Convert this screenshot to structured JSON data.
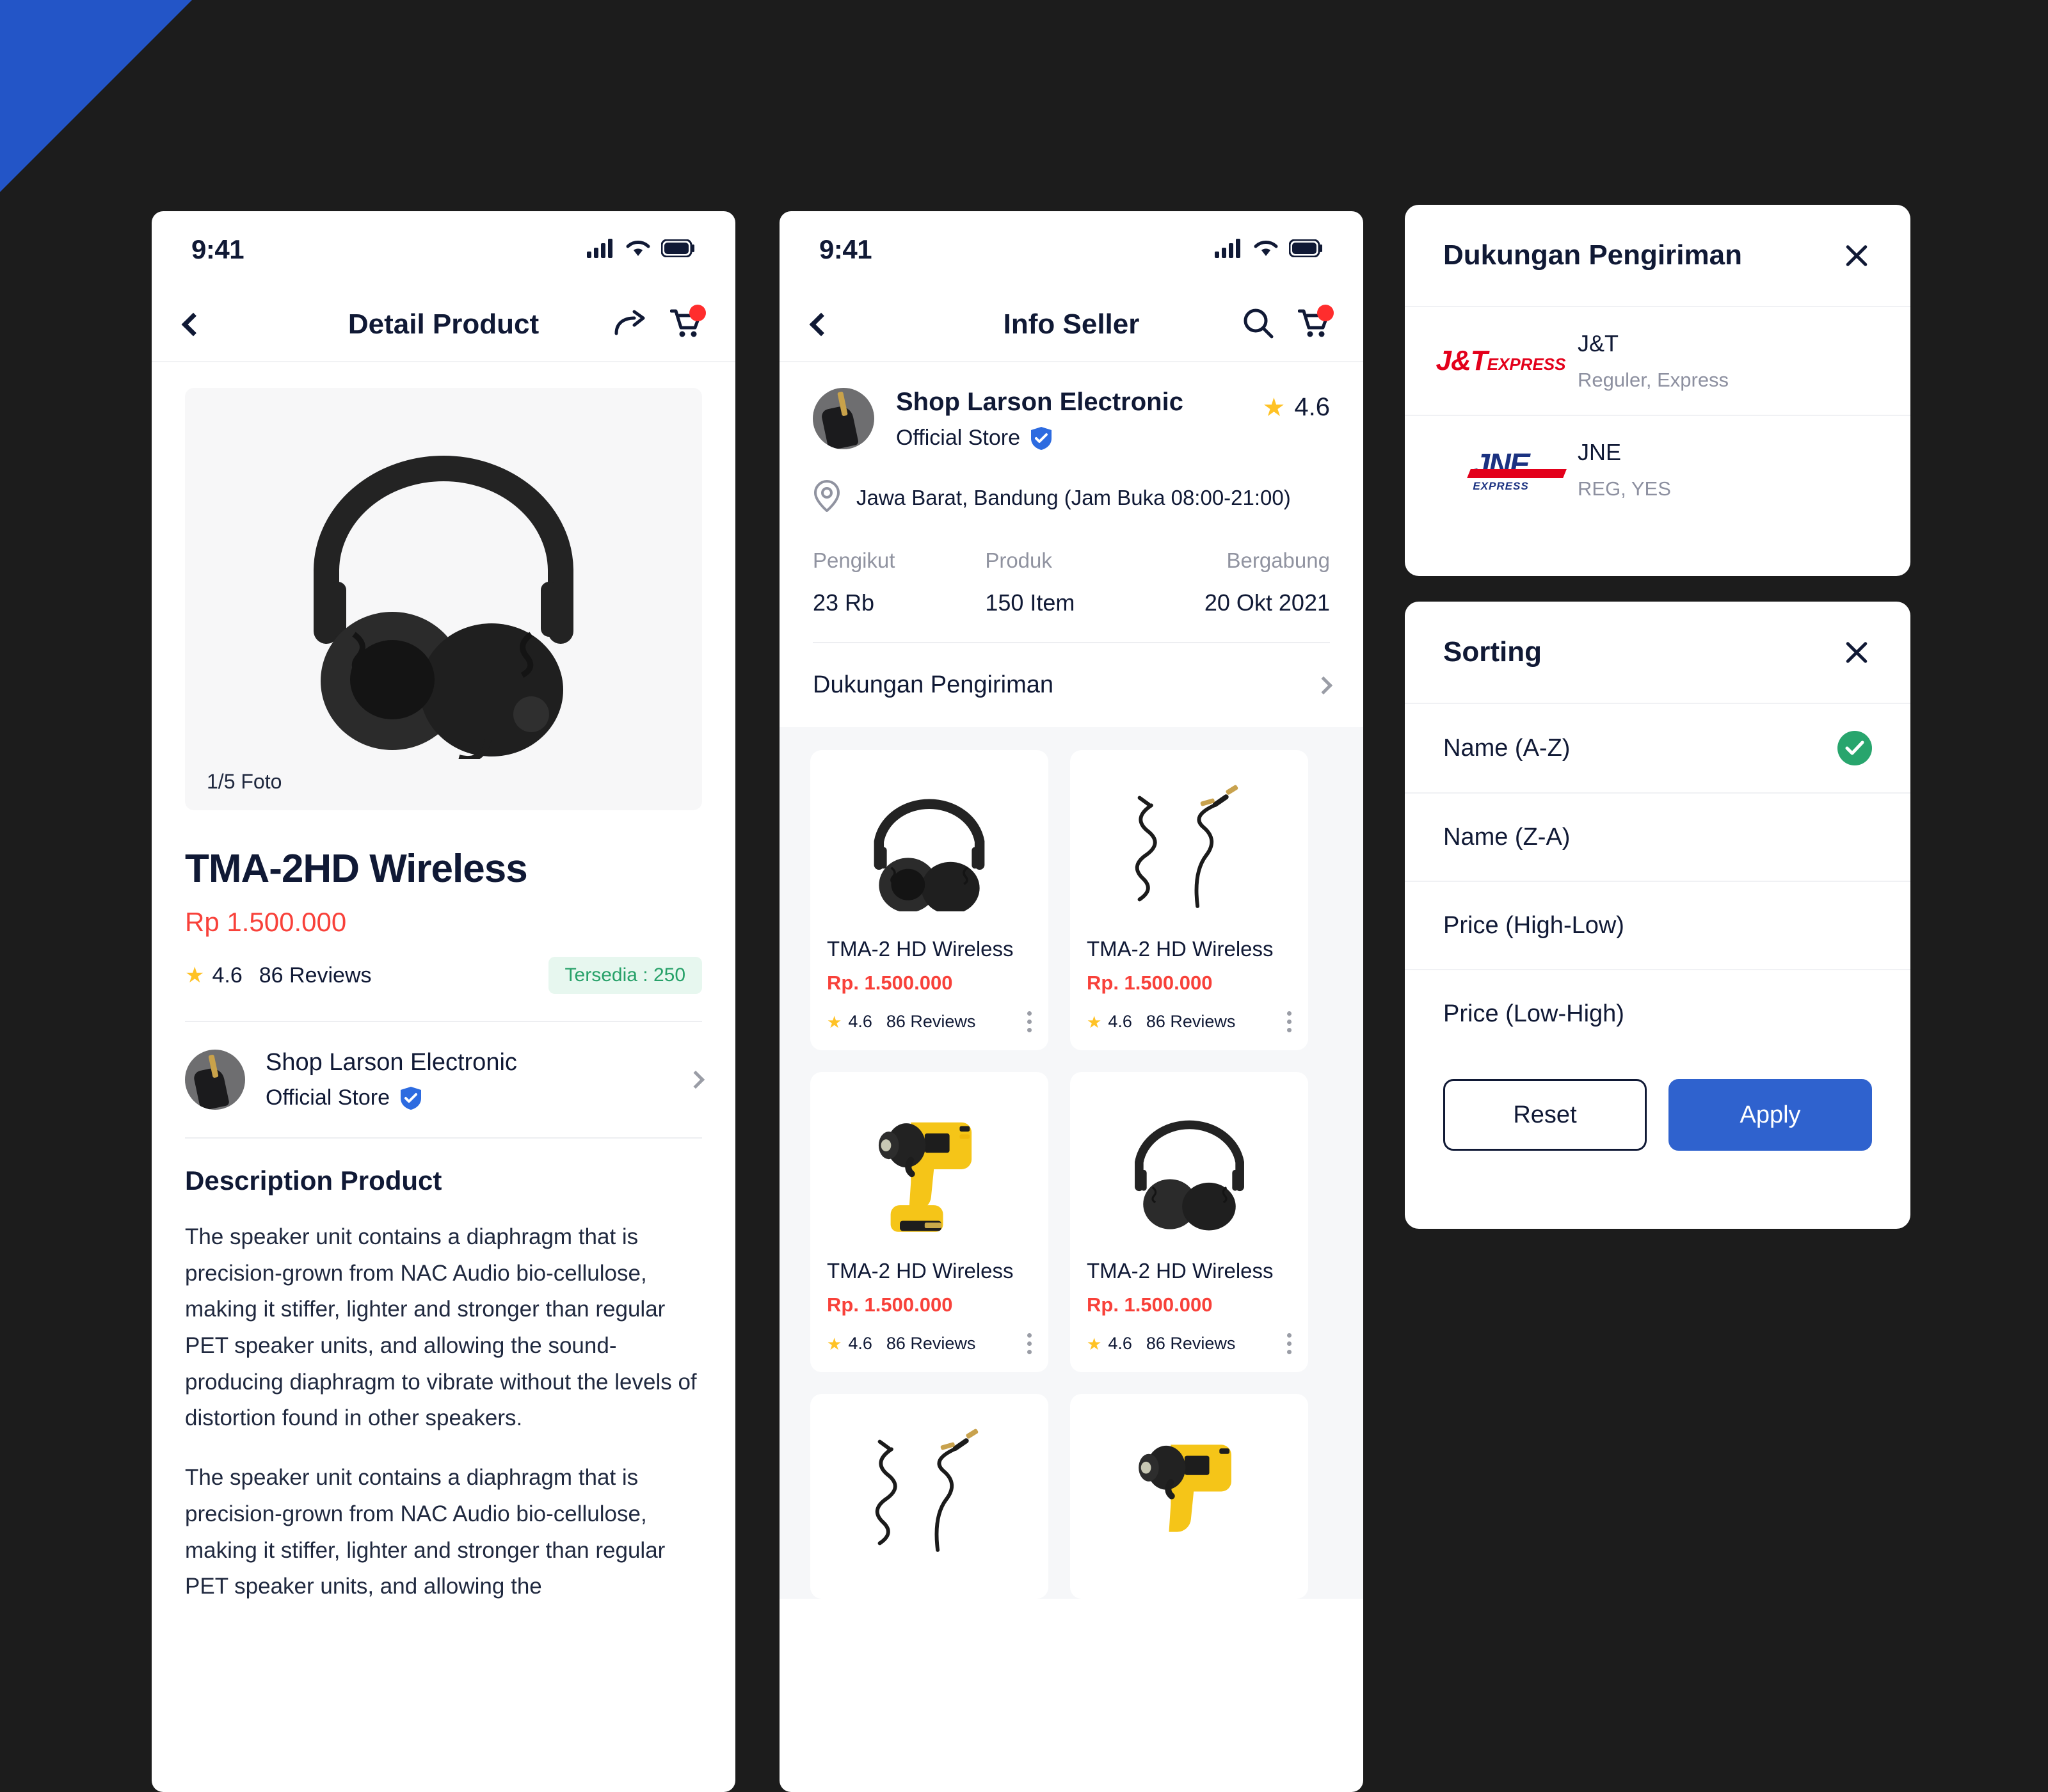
{
  "theme": {
    "accent_blue": "#2355C7",
    "background": "#1C1C1C",
    "price_red": "#F8413A",
    "star_yellow": "#FFC225",
    "success_green": "#28A56D",
    "apply_blue": "#2F62CE"
  },
  "detail_screen": {
    "status": {
      "time": "9:41",
      "signal_icon": "signal-bars-icon",
      "wifi_icon": "wifi-icon",
      "battery_icon": "battery-icon"
    },
    "nav": {
      "back_icon": "chevron-left-icon",
      "title": "Detail Product",
      "share_icon": "share-icon",
      "cart_icon": "cart-icon"
    },
    "gallery": {
      "counter": "1/5 Foto",
      "image": "headphones-image"
    },
    "product": {
      "title": "TMA-2HD Wireless",
      "price": "Rp 1.500.000",
      "rating": "4.6",
      "reviews": "86 Reviews",
      "stock_badge": "Tersedia : 250"
    },
    "store": {
      "name": "Shop Larson Electronic",
      "badge_label": "Official Store",
      "verified_icon": "verified-shield-icon",
      "chevron_icon": "chevron-right-icon"
    },
    "description": {
      "heading": "Description Product",
      "paragraphs": [
        "The speaker unit contains a diaphragm that is precision-grown from NAC Audio bio-cellulose, making it stiffer, lighter and stronger than regular PET speaker units, and allowing the sound-producing diaphragm to vibrate without the levels of distortion found in other speakers.",
        "The speaker unit contains a diaphragm that is precision-grown from NAC Audio bio-cellulose, making it stiffer, lighter and stronger than regular PET speaker units, and allowing the"
      ]
    }
  },
  "seller_screen": {
    "status": {
      "time": "9:41",
      "signal_icon": "signal-bars-icon",
      "wifi_icon": "wifi-icon",
      "battery_icon": "battery-icon"
    },
    "nav": {
      "back_icon": "chevron-left-icon",
      "title": "Info Seller",
      "search_icon": "search-icon",
      "cart_icon": "cart-icon"
    },
    "seller": {
      "name": "Shop Larson Electronic",
      "badge_label": "Official Store",
      "verified_icon": "verified-shield-icon",
      "rating": "4.6",
      "location_icon": "location-pin-icon",
      "location": "Jawa Barat, Bandung (Jam Buka 08:00-21:00)",
      "stats": [
        {
          "label": "Pengikut",
          "value": "23 Rb"
        },
        {
          "label": "Produk",
          "value": "150 Item"
        },
        {
          "label": "Bergabung",
          "value": "20 Okt 2021"
        }
      ],
      "shipping_row_label": "Dukungan Pengiriman",
      "shipping_row_icon": "chevron-right-icon"
    },
    "products": [
      {
        "image": "headphones-image",
        "name": "TMA-2 HD Wireless",
        "price": "Rp. 1.500.000",
        "rating": "4.6",
        "reviews": "86 Reviews",
        "menu_icon": "kebab-menu-icon"
      },
      {
        "image": "cable-image",
        "name": "TMA-2 HD Wireless",
        "price": "Rp. 1.500.000",
        "rating": "4.6",
        "reviews": "86 Reviews",
        "menu_icon": "kebab-menu-icon"
      },
      {
        "image": "drill-image",
        "name": "TMA-2 HD Wireless",
        "price": "Rp. 1.500.000",
        "rating": "4.6",
        "reviews": "86 Reviews",
        "menu_icon": "kebab-menu-icon"
      },
      {
        "image": "headphones-image",
        "name": "TMA-2 HD Wireless",
        "price": "Rp. 1.500.000",
        "rating": "4.6",
        "reviews": "86 Reviews",
        "menu_icon": "kebab-menu-icon"
      },
      {
        "image": "cable-image",
        "name": "",
        "price": "",
        "rating": "",
        "reviews": "",
        "menu_icon": "kebab-menu-icon"
      },
      {
        "image": "drill-image",
        "name": "",
        "price": "",
        "rating": "",
        "reviews": "",
        "menu_icon": "kebab-menu-icon"
      }
    ]
  },
  "shipping_modal": {
    "title": "Dukungan Pengiriman",
    "close_icon": "close-icon",
    "couriers": [
      {
        "logo": "jnt-express-logo",
        "logo_main": "J&T",
        "logo_sub": "EXPRESS",
        "name": "J&T",
        "services": "Reguler, Express"
      },
      {
        "logo": "jne-express-logo",
        "logo_main": "JNE",
        "logo_sub": "EXPRESS",
        "name": "JNE",
        "services": "REG, YES"
      }
    ]
  },
  "sorting_modal": {
    "title": "Sorting",
    "close_icon": "close-icon",
    "options": [
      {
        "label": "Name (A-Z)",
        "selected": true,
        "check_icon": "check-circle-icon"
      },
      {
        "label": "Name (Z-A)",
        "selected": false
      },
      {
        "label": "Price (High-Low)",
        "selected": false
      },
      {
        "label": "Price (Low-High)",
        "selected": false
      }
    ],
    "reset_label": "Reset",
    "apply_label": "Apply"
  }
}
